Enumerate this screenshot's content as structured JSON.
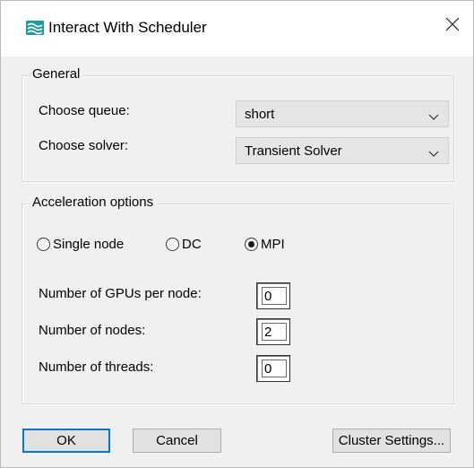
{
  "window": {
    "title": "Interact With Scheduler",
    "accent_color": "#1f9aa0"
  },
  "icons": {
    "app": "scheduler-app-icon",
    "close": "close-icon",
    "dropdown": "chevron-down-icon"
  },
  "general": {
    "legend": "General",
    "queue_label": "Choose queue:",
    "queue_value": "short",
    "solver_label": "Choose solver:",
    "solver_value": "Transient Solver"
  },
  "acceleration": {
    "legend": "Acceleration options",
    "options": [
      {
        "label": "Single node",
        "checked": false
      },
      {
        "label": "DC",
        "checked": false
      },
      {
        "label": "MPI",
        "checked": true
      }
    ],
    "gpus_label": "Number of GPUs per node:",
    "gpus_value": "0",
    "nodes_label": "Number of nodes:",
    "nodes_value": "2",
    "threads_label": "Number of threads:",
    "threads_value": "0"
  },
  "buttons": {
    "ok": "OK",
    "cancel": "Cancel",
    "cluster_settings": "Cluster Settings..."
  }
}
